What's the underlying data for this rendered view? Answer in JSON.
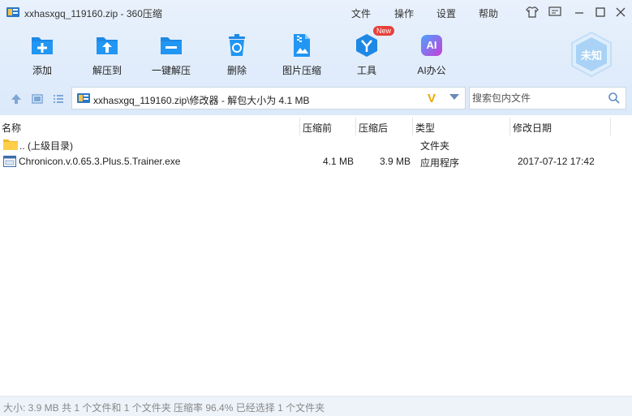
{
  "window": {
    "title": "xxhasxgq_119160.zip - 360压缩",
    "menu": [
      "文件",
      "操作",
      "设置",
      "帮助"
    ]
  },
  "toolbar": {
    "items": [
      {
        "label": "添加",
        "icon": "add-icon"
      },
      {
        "label": "解压到",
        "icon": "extract-to-icon"
      },
      {
        "label": "一键解压",
        "icon": "one-click-extract-icon"
      },
      {
        "label": "删除",
        "icon": "trash-icon"
      },
      {
        "label": "图片压缩",
        "icon": "image-compress-icon"
      },
      {
        "label": "工具",
        "icon": "tools-icon",
        "badge": "New"
      },
      {
        "label": "AI办公",
        "icon": "ai-office-icon",
        "icon_text": "AI"
      }
    ],
    "shield_label": "未知"
  },
  "address": {
    "path": "xxhasxgq_119160.zip\\修改器 - 解包大小为 4.1 MB",
    "v_mark": "V"
  },
  "search": {
    "placeholder": "搜索包内文件"
  },
  "columns": [
    "名称",
    "压缩前",
    "压缩后",
    "类型",
    "修改日期"
  ],
  "files": [
    {
      "name": ".. (上级目录)",
      "before": "",
      "after": "",
      "type": "文件夹",
      "date": "",
      "icon": "folder-icon"
    },
    {
      "name": "Chronicon.v.0.65.3.Plus.5.Trainer.exe",
      "before": "4.1 MB",
      "after": "3.9 MB",
      "type": "应用程序",
      "date": "2017-07-12 17:42",
      "icon": "exe-file-icon"
    }
  ],
  "status": "大小: 3.9 MB 共 1 个文件和 1 个文件夹 压缩率 96.4% 已经选择 1 个文件夹",
  "colors": {
    "accent": "#2b8ce6",
    "header_bg": "#e3eefb",
    "new_badge": "#e8403a"
  }
}
